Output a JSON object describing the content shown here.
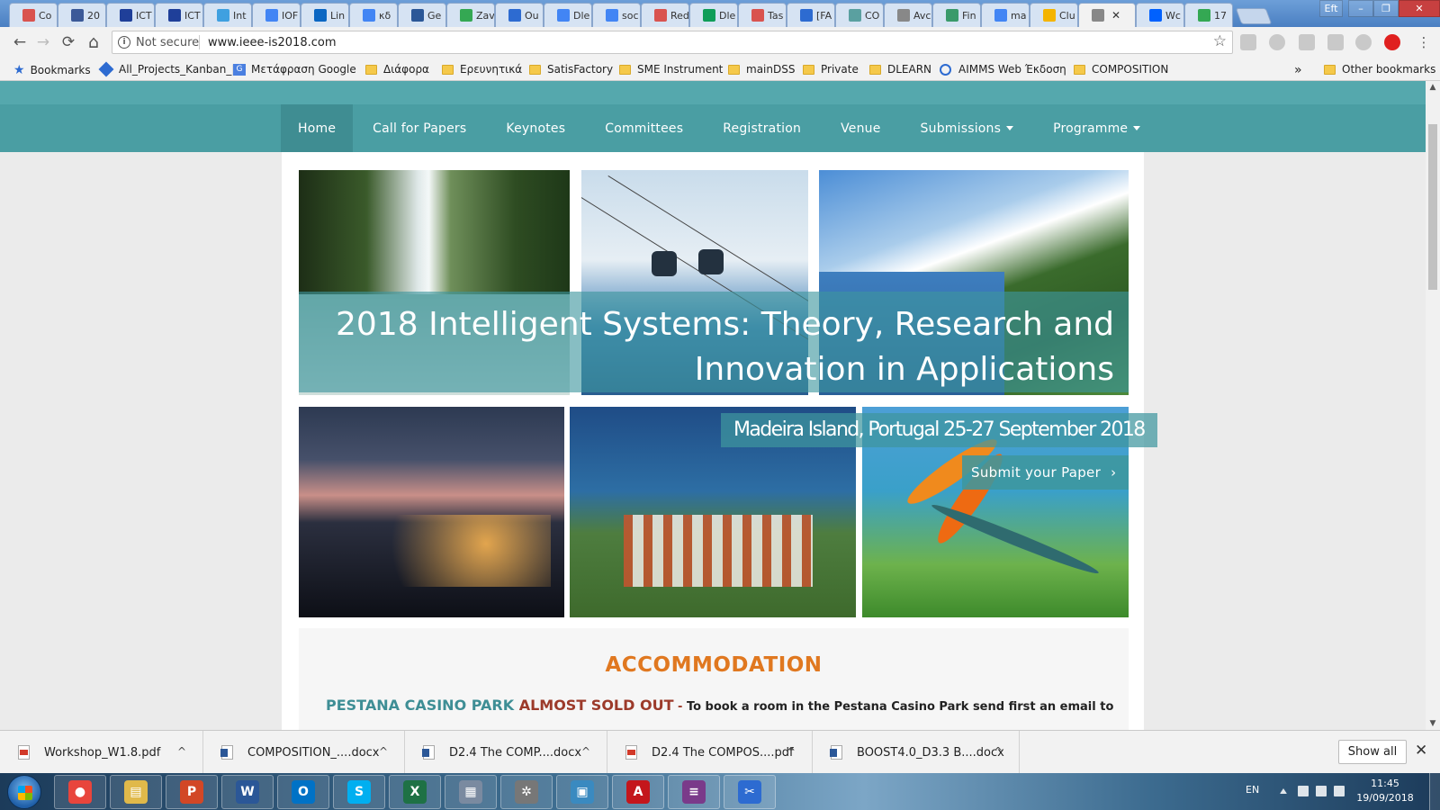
{
  "browser": {
    "tabs": [
      {
        "title": "Co",
        "icon": "doc-red-icon",
        "color": "#d9534f"
      },
      {
        "title": "20",
        "icon": "facebook-icon",
        "color": "#3b5998"
      },
      {
        "title": "ICT",
        "icon": "eu-flag-icon",
        "color": "#1f3f99"
      },
      {
        "title": "ICT",
        "icon": "eu-flag-icon",
        "color": "#1f3f99"
      },
      {
        "title": "Int",
        "icon": "d-icon",
        "color": "#3fa0e0"
      },
      {
        "title": "IOF",
        "icon": "doc-blue-icon",
        "color": "#4285f4"
      },
      {
        "title": "Lin",
        "icon": "linkedin-icon",
        "color": "#0a66c2"
      },
      {
        "title": "κδ",
        "icon": "google-icon",
        "color": "#4285f4"
      },
      {
        "title": "Ge",
        "icon": "b-icon",
        "color": "#2b5797"
      },
      {
        "title": "Zav",
        "icon": "maps-icon",
        "color": "#34a853"
      },
      {
        "title": "Ou",
        "icon": "confluence-icon",
        "color": "#2d6bd1"
      },
      {
        "title": "Dle",
        "icon": "calendar-icon",
        "color": "#4285f4"
      },
      {
        "title": "soc",
        "icon": "google-icon",
        "color": "#4285f4"
      },
      {
        "title": "Red",
        "icon": "doc-red-icon",
        "color": "#d9534f"
      },
      {
        "title": "Dle",
        "icon": "sheets-icon",
        "color": "#0f9d58"
      },
      {
        "title": "Tas",
        "icon": "doc-red-icon",
        "color": "#d9534f"
      },
      {
        "title": "[FA",
        "icon": "fa-icon",
        "color": "#2d6bd1"
      },
      {
        "title": "CO",
        "icon": "co-icon",
        "color": "#5aa0a0"
      },
      {
        "title": "Avc",
        "icon": "page-icon",
        "color": "#888888"
      },
      {
        "title": "Fin",
        "icon": "fin-icon",
        "color": "#3a9a6a"
      },
      {
        "title": "ma",
        "icon": "google-icon",
        "color": "#4285f4"
      },
      {
        "title": "Clu",
        "icon": "drive-icon",
        "color": "#f4b400"
      },
      {
        "title": "",
        "icon": "page-icon",
        "color": "#888888",
        "active": true
      },
      {
        "title": "Wc",
        "icon": "dropbox-icon",
        "color": "#0061fe"
      },
      {
        "title": "17",
        "icon": "drive-icon",
        "color": "#34a853"
      }
    ],
    "active_tab_close": "✕",
    "window_controls": {
      "user": "Eft",
      "minimize": "–",
      "maximize": "❐",
      "close": "✕"
    }
  },
  "toolbar": {
    "back": "←",
    "forward": "→",
    "reload": "⟳",
    "home": "⌂",
    "security_label": "Not secure",
    "url": "www.ieee-is2018.com",
    "star": "☆"
  },
  "bookmarks": {
    "items": [
      {
        "label": "Bookmarks",
        "icon": "star-icon"
      },
      {
        "label": "All_Projects_Kanban_|",
        "icon": "diamond-icon"
      },
      {
        "label": "Μετάφραση Google",
        "icon": "translate-icon"
      },
      {
        "label": "Διάφορα",
        "icon": "folder-icon"
      },
      {
        "label": "Ερευνητικά",
        "icon": "folder-icon"
      },
      {
        "label": "SatisFactory",
        "icon": "folder-icon"
      },
      {
        "label": "SME Instrument",
        "icon": "folder-icon"
      },
      {
        "label": "mainDSS",
        "icon": "folder-icon"
      },
      {
        "label": "Private",
        "icon": "folder-icon"
      },
      {
        "label": "DLEARN",
        "icon": "folder-icon"
      },
      {
        "label": "AIMMS Web Έκδοση",
        "icon": "aimms-icon"
      },
      {
        "label": "COMPOSITION",
        "icon": "folder-icon"
      }
    ],
    "overflow": "»",
    "other": "Other bookmarks"
  },
  "site": {
    "nav": [
      {
        "label": "Home",
        "active": true,
        "dropdown": false
      },
      {
        "label": "Call for Papers",
        "active": false,
        "dropdown": false
      },
      {
        "label": "Keynotes",
        "active": false,
        "dropdown": false
      },
      {
        "label": "Committees",
        "active": false,
        "dropdown": false
      },
      {
        "label": "Registration",
        "active": false,
        "dropdown": false
      },
      {
        "label": "Venue",
        "active": false,
        "dropdown": false
      },
      {
        "label": "Submissions",
        "active": false,
        "dropdown": true
      },
      {
        "label": "Programme",
        "active": false,
        "dropdown": true
      }
    ],
    "hero": {
      "title_line1": "2018 Intelligent Systems: Theory, Research and",
      "title_line2": "Innovation in Applications",
      "subtitle": "Madeira Island, Portugal 25-27 September 2018",
      "cta": "Submit your Paper",
      "cta_arrow": "›"
    },
    "accommodation": {
      "heading": "ACCOMMODATION",
      "hotel": "PESTANA CASINO PARK",
      "status": "ALMOST SOLD OUT",
      "dash": " - ",
      "text": "To book a room in the Pestana Casino Park send first an email to"
    },
    "colors": {
      "teal": "#4a9ea3",
      "orange": "#e07820",
      "dark_red": "#9c3a2a"
    }
  },
  "downloads": {
    "items": [
      {
        "name": "Workshop_W1.8.pdf",
        "type": "pdf"
      },
      {
        "name": "COMPOSITION_....docx",
        "type": "doc"
      },
      {
        "name": "D2.4 The COMP....docx",
        "type": "doc"
      },
      {
        "name": "D2.4 The COMPOS....pdf",
        "type": "pdf"
      },
      {
        "name": "BOOST4.0_D3.3 B....docx",
        "type": "doc"
      }
    ],
    "chevron": "^",
    "show_all": "Show all",
    "close": "✕"
  },
  "taskbar": {
    "apps": [
      {
        "name": "chrome",
        "glyph": "●",
        "color": "#e8453c"
      },
      {
        "name": "explorer",
        "glyph": "▤",
        "color": "#e0b94a"
      },
      {
        "name": "powerpoint",
        "glyph": "P",
        "color": "#d24726"
      },
      {
        "name": "word",
        "glyph": "W",
        "color": "#2b5797"
      },
      {
        "name": "outlook",
        "glyph": "O",
        "color": "#0072c6"
      },
      {
        "name": "skype",
        "glyph": "S",
        "color": "#00aff0"
      },
      {
        "name": "excel",
        "glyph": "X",
        "color": "#1e7145"
      },
      {
        "name": "calculator",
        "glyph": "▦",
        "color": "#7a8aa0"
      },
      {
        "name": "settings",
        "glyph": "✲",
        "color": "#777777"
      },
      {
        "name": "photos",
        "glyph": "▣",
        "color": "#3a8ac0"
      },
      {
        "name": "acrobat",
        "glyph": "A",
        "color": "#c4161c"
      },
      {
        "name": "winrar",
        "glyph": "≡",
        "color": "#7a3a8a"
      },
      {
        "name": "snipping",
        "glyph": "✂",
        "color": "#2d6bd1"
      }
    ],
    "language": "EN",
    "time": "11:45",
    "date": "19/09/2018"
  }
}
